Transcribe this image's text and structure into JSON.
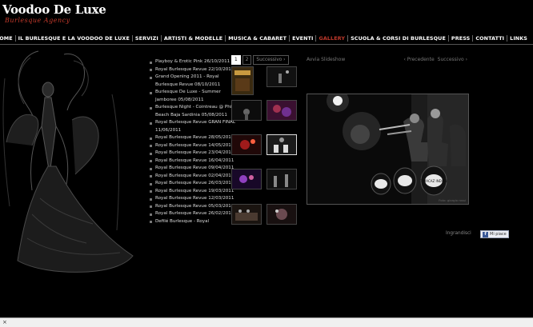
{
  "site": {
    "logo_main": "Voodoo De Luxe",
    "logo_sub": "Burlesque Agency"
  },
  "nav": {
    "items": [
      {
        "label": "HOME"
      },
      {
        "label": "IL BURLESQUE E LA VOODOO DE LUXE"
      },
      {
        "label": "SERVIZI"
      },
      {
        "label": "ARTISTI & MODELLE"
      },
      {
        "label": "MUSICA & CABARET"
      },
      {
        "label": "EVENTI"
      },
      {
        "label": "GALLERY",
        "active": true
      },
      {
        "label": "SCUOLA & CORSI DI BURLESQUE"
      },
      {
        "label": "PRESS"
      },
      {
        "label": "CONTATTI"
      },
      {
        "label": "LINKS"
      }
    ]
  },
  "gallery_list": [
    "Playboy & Erotic Pink 26/10/2011",
    "Royal Burlesque Revue 22/10/2011",
    "Grand Opening 2011 - Royal Burlesque Revue 08/10/2011",
    "Burlesque De Luxe - Summer Jamboree 05/08/2011",
    "Burlesque Night - Cointreau @ Phi Beach Baja Sardinia 05/08/2011",
    "Royal Burlesque Revue GRAN FINAL 11/06/2011",
    "Royal Burlesque Revue 28/05/2011",
    "Royal Burlesque Revue 14/05/2011",
    "Royal Burlesque Revue 23/04/2011",
    "Royal Burlesque Revue 16/04/2011",
    "Royal Burlesque Revue 09/04/2011",
    "Royal Burlesque Revue 02/04/2011",
    "Royal Burlesque Revue 26/03/2011",
    "Royal Burlesque Revue 19/03/2011",
    "Royal Burlesque Revue 12/03/2011",
    "Royal Burlesque Revue 05/03/2011",
    "Royal Burlesque Revue 26/02/2011",
    "Defilé Burlesque - Royal"
  ],
  "pager": {
    "page1": "1",
    "page2": "2",
    "next": "Successivo ›"
  },
  "viewer": {
    "slideshow": "Avvia Slideshow",
    "prev": "‹ Precedente",
    "next": "Successivo ›",
    "credit": "Foto: giorgio rossi",
    "drum_text": "T'MACAZ INDIAN",
    "enlarge": "Ingrandisci"
  },
  "like": {
    "fb_letter": "f",
    "label": "Mi piace"
  },
  "statusbar": {
    "close": "×"
  },
  "colors": {
    "background": "#000000",
    "accent": "#c0392b",
    "text": "#dddddd"
  }
}
